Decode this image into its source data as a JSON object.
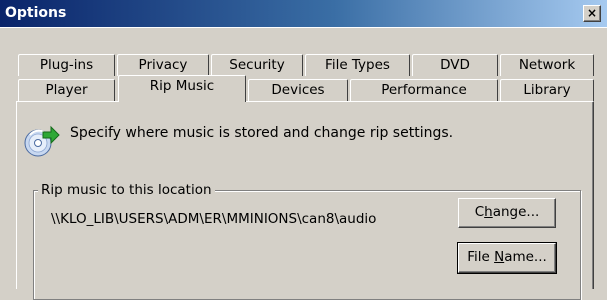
{
  "window": {
    "title": "Options",
    "close_glyph": "×"
  },
  "tabs_back_row": [
    {
      "label": "Plug-ins"
    },
    {
      "label": "Privacy"
    },
    {
      "label": "Security"
    },
    {
      "label": "File Types"
    },
    {
      "label": "DVD"
    },
    {
      "label": "Network"
    }
  ],
  "tabs_front_row": [
    {
      "label": "Player"
    },
    {
      "label": "Rip Music",
      "selected": true
    },
    {
      "label": "Devices"
    },
    {
      "label": "Performance"
    },
    {
      "label": "Library"
    }
  ],
  "rip_music": {
    "icon": "cd-rip-icon",
    "description": "Specify where music is stored and change rip settings.",
    "location_group_label": "Rip music to this location",
    "location_path": "\\\\KLO_LIB\\USERS\\ADM\\ER\\MMINIONS\\can8\\audio",
    "change_button": {
      "pre": "C",
      "accel": "h",
      "post": "ange..."
    },
    "filename_button": {
      "pre": "File ",
      "accel": "N",
      "post": "ame..."
    }
  }
}
